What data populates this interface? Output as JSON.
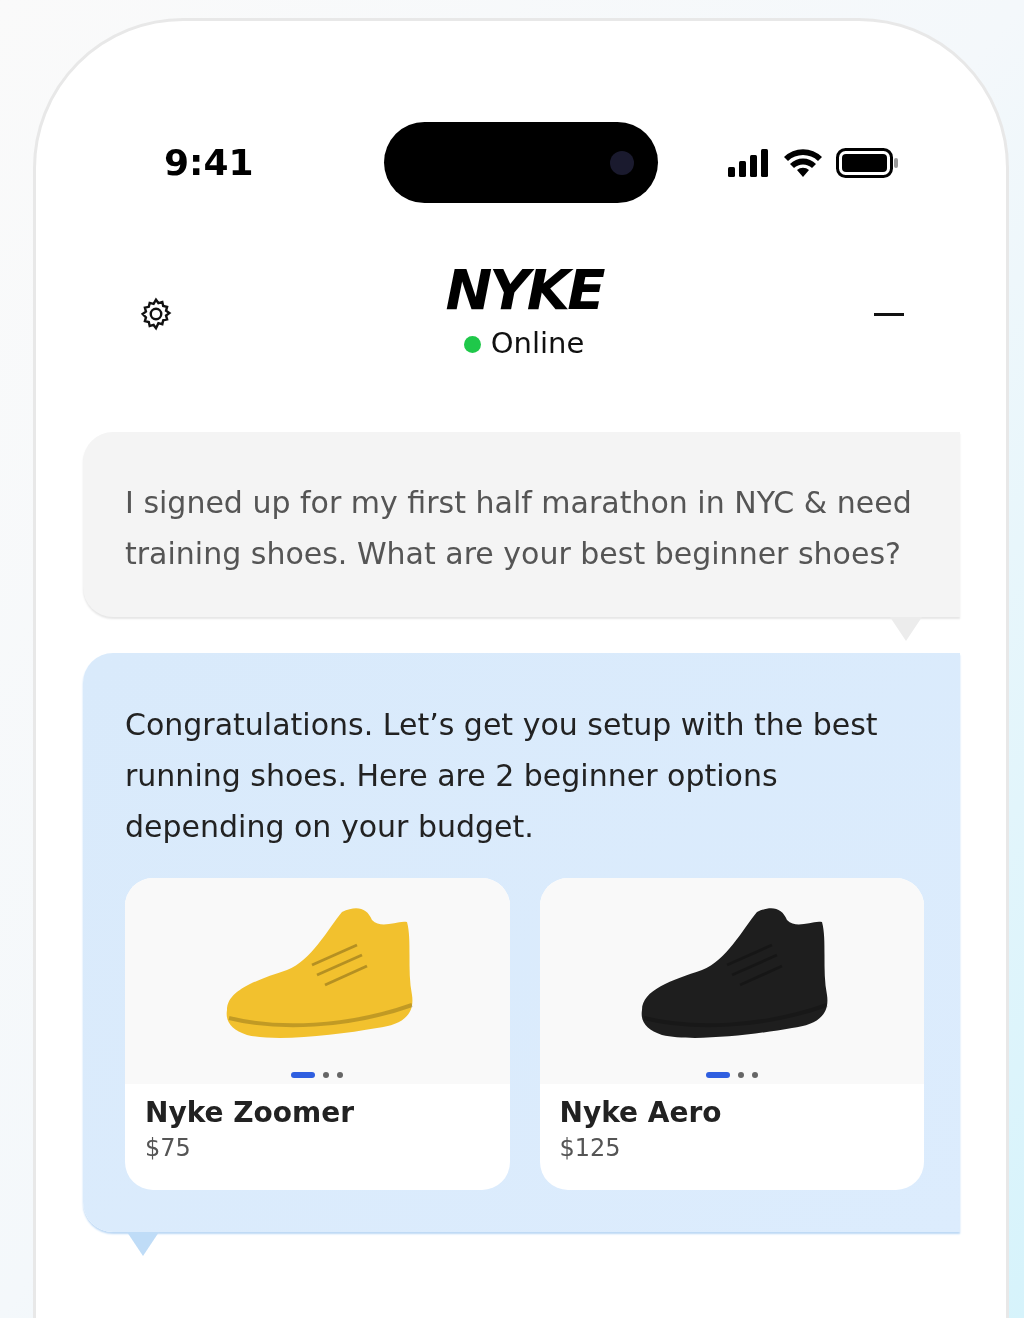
{
  "status_bar": {
    "time": "9:41"
  },
  "header": {
    "logo": "NYKE",
    "status": "Online",
    "online": true
  },
  "messages": [
    {
      "kind": "user",
      "text": "I signed up for my first half marathon in NYC & need training shoes. What are your best beginner shoes?"
    },
    {
      "kind": "bot",
      "text": "Congratulations. Let’s get you setup with the best running shoes. Here are 2 beginner options depending on your budget.",
      "products": [
        {
          "name": "Nyke Zoomer",
          "price": "$75",
          "color": "#f2c12e",
          "dots": [
            {
              "selected": true
            },
            {
              "selected": false
            },
            {
              "selected": false
            }
          ]
        },
        {
          "name": "Nyke Aero",
          "price": "$125",
          "color": "#1e1e1e",
          "dots": [
            {
              "selected": true
            },
            {
              "selected": false
            },
            {
              "selected": false
            }
          ]
        }
      ]
    }
  ]
}
